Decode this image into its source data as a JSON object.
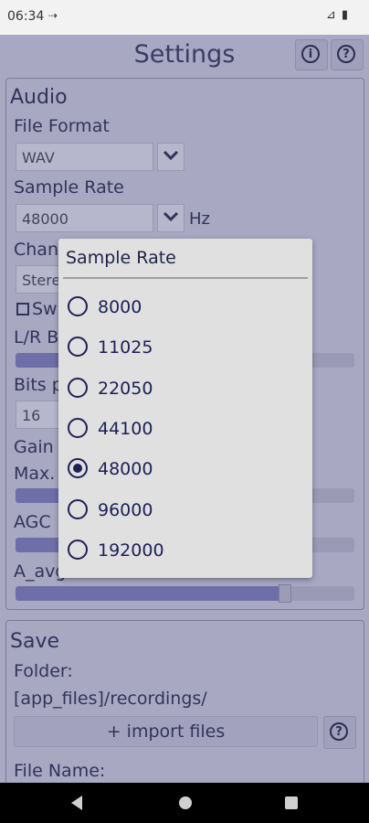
{
  "status_bar": {
    "time": "06:34",
    "cast_glyph": "⇢",
    "right_glyphs": "⊿ ▮"
  },
  "header": {
    "title": "Settings",
    "info_glyph": "i",
    "help_glyph": "?"
  },
  "audio": {
    "section_title": "Audio",
    "file_format_label": "File Format",
    "file_format_value": "WAV",
    "sample_rate_label": "Sample Rate",
    "sample_rate_value": "48000",
    "sample_rate_unit": "Hz",
    "channels_label_partial": "Chan",
    "channels_value_partial": "Stere",
    "swap_label_partial": "Sw",
    "lr_balance_label_partial": "L/R B",
    "bits_label_partial": "Bits p",
    "bits_value_partial": "16",
    "gain_label_partial": "Gain",
    "max_label_partial": "Max.",
    "agc_label_partial": "AGC",
    "a_avg_label": "A_avg"
  },
  "save": {
    "section_title": "Save",
    "folder_label": "Folder:",
    "folder_value": "[app_files]/recordings/",
    "import_button": "+ import files",
    "help_glyph": "?",
    "file_name_label": "File Name:"
  },
  "dialog": {
    "title": "Sample Rate",
    "options": [
      "8000",
      "11025",
      "22050",
      "44100",
      "48000",
      "96000",
      "192000"
    ],
    "selected": "48000"
  }
}
